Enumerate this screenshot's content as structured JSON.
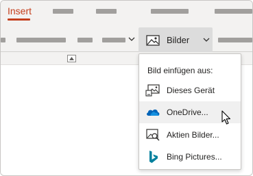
{
  "tabs": {
    "active_label": "Insert"
  },
  "ribbon": {
    "bilder_label": "Bilder"
  },
  "menu": {
    "header": "Bild einfügen aus:",
    "items": [
      {
        "label": "Dieses Gerät",
        "icon": "device-picture-icon"
      },
      {
        "label": "OneDrive...",
        "icon": "onedrive-cloud-icon"
      },
      {
        "label": "Aktien Bilder...",
        "icon": "stock-images-icon"
      },
      {
        "label": "Bing Pictures...",
        "icon": "bing-icon"
      }
    ]
  },
  "colors": {
    "accent": "#c43e1c",
    "onedrive": "#0364b8",
    "bing": "#00809d",
    "icon": "#323130"
  }
}
